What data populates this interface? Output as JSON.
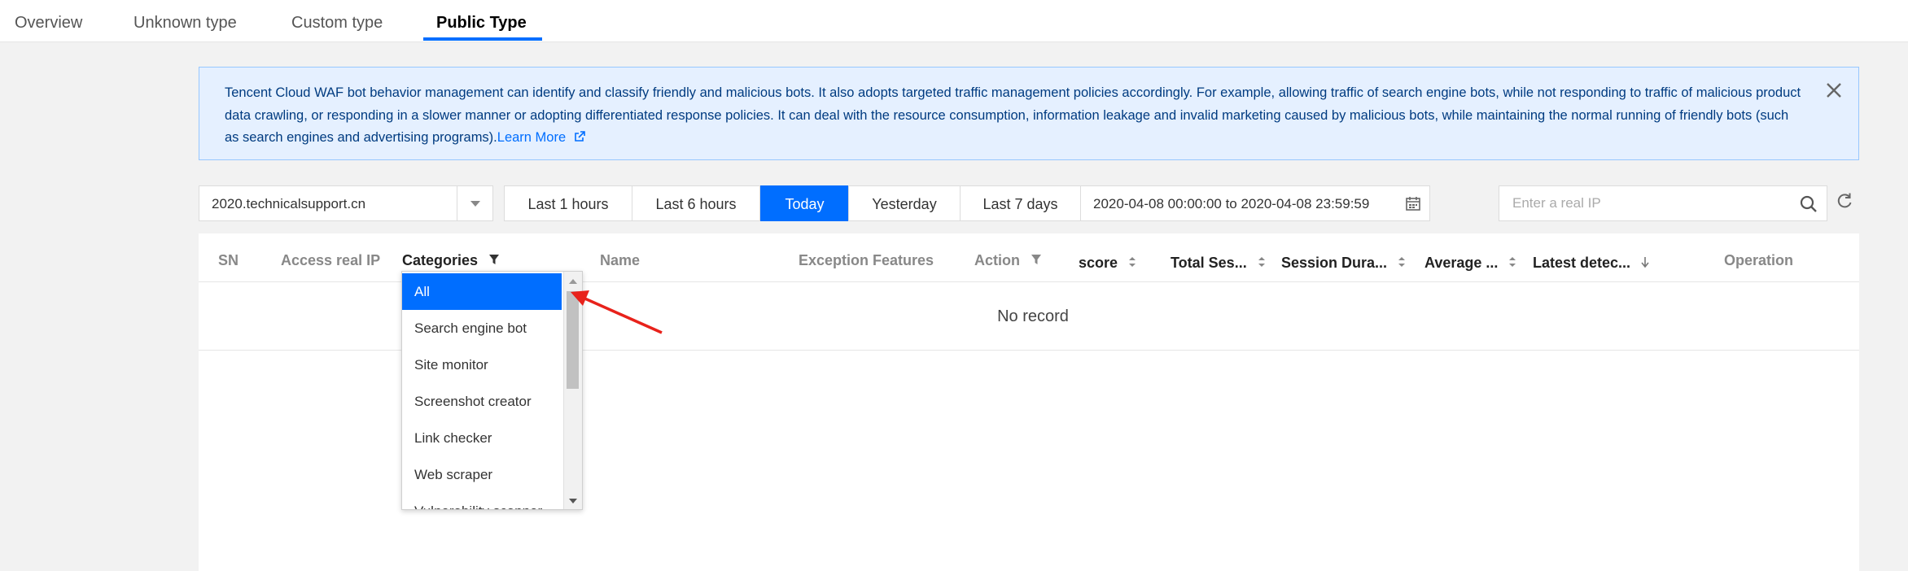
{
  "tabs": [
    {
      "label": "Overview",
      "active": false
    },
    {
      "label": "Unknown type",
      "active": false
    },
    {
      "label": "Custom type",
      "active": false
    },
    {
      "label": "Public Type",
      "active": true
    }
  ],
  "notice": {
    "text": "Tencent Cloud WAF bot behavior management can identify and classify friendly and malicious bots. It also adopts targeted traffic management policies accordingly. For example, allowing traffic of search engine bots, while not responding to traffic of malicious product data crawling, or responding in a slower manner or adopting differentiated response policies. It can deal with the resource consumption, information leakage and invalid marketing caused by malicious bots, while maintaining the normal running of friendly bots (such as search engines and advertising programs).",
    "link_label": "Learn More"
  },
  "toolbar": {
    "domain": "2020.technicalsupport.cn",
    "ranges": [
      "Last 1 hours",
      "Last 6 hours",
      "Today",
      "Yesterday",
      "Last 7 days"
    ],
    "active_range": "Today",
    "date_range": "2020-04-08 00:00:00 to 2020-04-08 23:59:59",
    "search_placeholder": "Enter a real IP"
  },
  "table": {
    "columns": [
      "SN",
      "Access real IP",
      "Categories",
      "Name",
      "Exception Features",
      "Action",
      "score",
      "Total Ses...",
      "Session Dura...",
      "Average ...",
      "Latest detec...",
      "Operation"
    ],
    "empty_text": "No record"
  },
  "category_dropdown": {
    "options": [
      "All",
      "Search engine bot",
      "Site monitor",
      "Screenshot creator",
      "Link checker",
      "Web scraper",
      "Vulnerability scanner"
    ],
    "selected": "All"
  },
  "colors": {
    "accent": "#006eff",
    "notice_bg": "#e5f0ff",
    "annotation": "#e8221b"
  }
}
